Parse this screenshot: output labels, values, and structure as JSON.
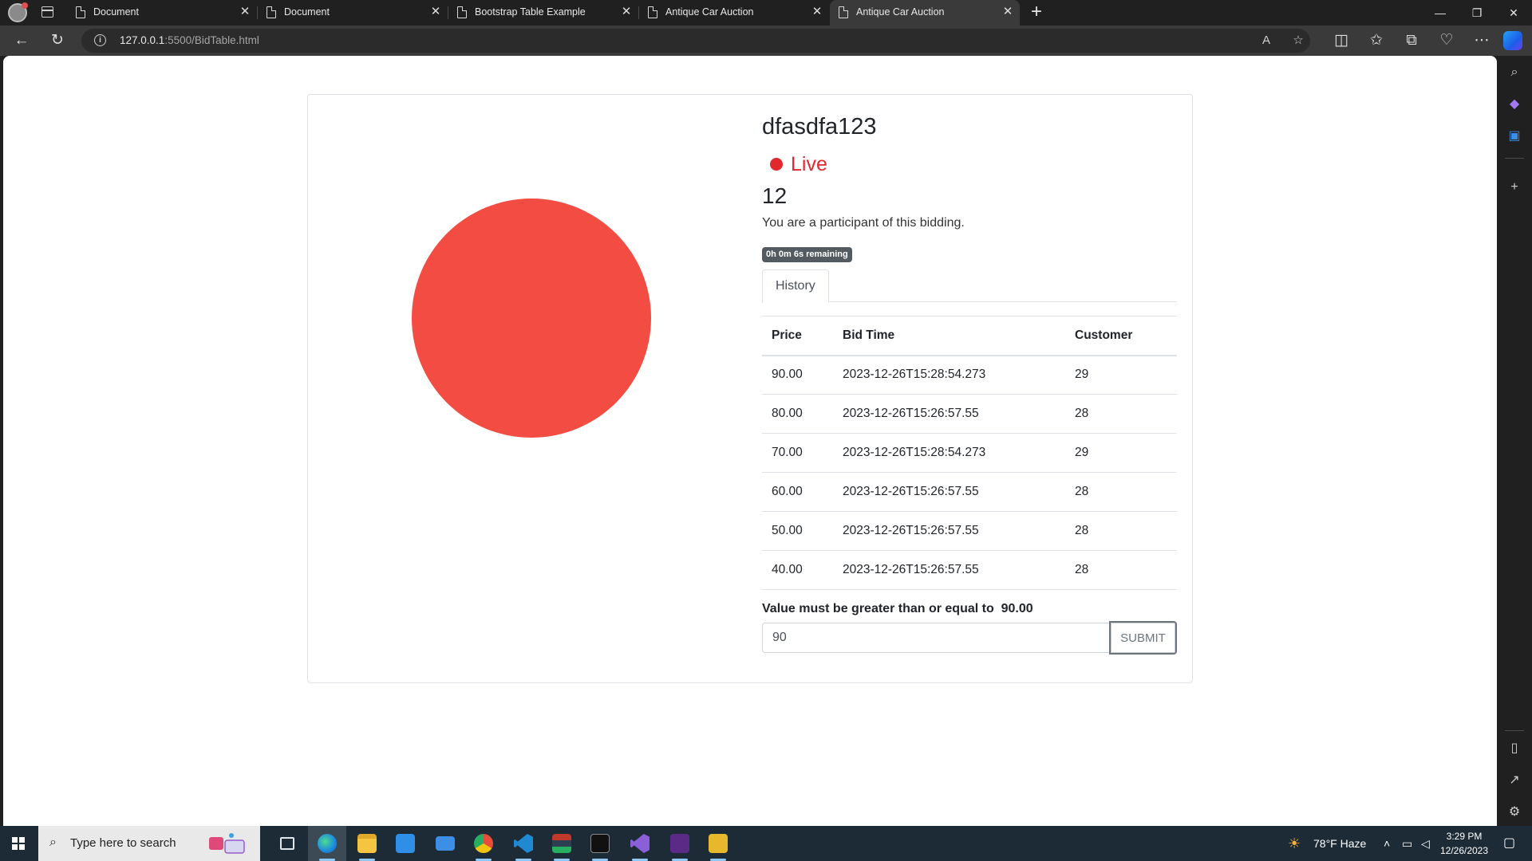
{
  "browser": {
    "tabs": [
      {
        "title": "Document",
        "active": false
      },
      {
        "title": "Document",
        "active": false
      },
      {
        "title": "Bootstrap Table Example",
        "active": false
      },
      {
        "title": "Antique Car Auction",
        "active": false
      },
      {
        "title": "Antique Car Auction",
        "active": true
      }
    ],
    "url_host": "127.0.0.1",
    "url_rest": ":5500/BidTable.html"
  },
  "auction": {
    "item_name": "dfasdfa123",
    "status": "Live",
    "status_color": "#e1282d",
    "bid_count": "12",
    "participant_message": "You are a participant of this bidding.",
    "time_remaining": "0h 0m 6s remaining",
    "tab_label": "History",
    "table": {
      "headers": [
        "Price",
        "Bid Time",
        "Customer"
      ],
      "rows": [
        [
          "90.00",
          "2023-12-26T15:28:54.273",
          "29"
        ],
        [
          "80.00",
          "2023-12-26T15:26:57.55",
          "28"
        ],
        [
          "70.00",
          "2023-12-26T15:28:54.273",
          "29"
        ],
        [
          "60.00",
          "2023-12-26T15:26:57.55",
          "28"
        ],
        [
          "50.00",
          "2023-12-26T15:26:57.55",
          "28"
        ],
        [
          "40.00",
          "2023-12-26T15:26:57.55",
          "28"
        ]
      ]
    },
    "min_bid_label": "Value must be greater than or equal to  90.00",
    "bid_input_value": "90",
    "submit_label": "SUBMIT",
    "image_color": "#f34c42"
  },
  "taskbar": {
    "search_placeholder": "Type here to search",
    "weather": "78°F  Haze",
    "time": "3:29 PM",
    "date": "12/26/2023"
  }
}
